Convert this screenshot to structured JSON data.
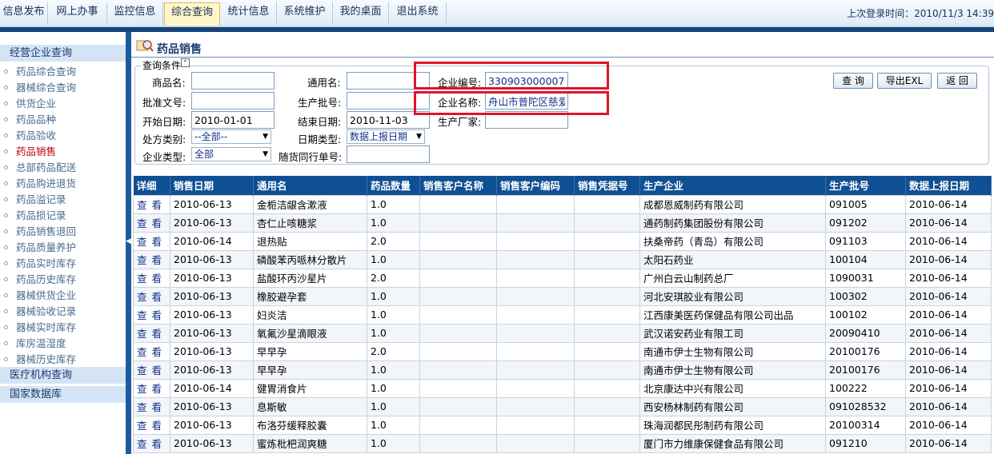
{
  "nav": {
    "items": [
      "信息发布",
      "网上办事",
      "监控信息",
      "综合查询",
      "统计信息",
      "系统维护",
      "我的桌面",
      "退出系统"
    ],
    "active": "综合查询",
    "last_login": "上次登录时间：2010/11/3 14:39"
  },
  "sidebar": {
    "section1": "经营企业查询",
    "items": [
      "药品综合查询",
      "器械综合查询",
      "供货企业",
      "药品品种",
      "药品验收",
      "药品销售",
      "总部药品配送",
      "药品购进退货",
      "药品溢记录",
      "药品损记录",
      "药品销售退回",
      "药品质量养护",
      "药品实时库存",
      "药品历史库存",
      "器械供货企业",
      "器械验收记录",
      "器械实时库存",
      "库房温湿度",
      "器械历史库存"
    ],
    "active": "药品销售",
    "section2": "医疗机构查询",
    "section3": "国家数据库"
  },
  "page": {
    "title": "药品销售"
  },
  "query": {
    "legend": "查询条件",
    "labels": {
      "product_name": "商品名:",
      "generic_name": "通用名:",
      "company_code": "企业编号:",
      "approval_no": "批准文号:",
      "batch_no": "生产批号:",
      "company_name": "企业名称:",
      "start_date": "开始日期:",
      "end_date": "结束日期:",
      "manufacturer": "生产厂家:",
      "rx_type": "处方类别:",
      "date_type": "日期类型:",
      "company_type": "企业类型:",
      "waybill_no": "随货同行单号:"
    },
    "values": {
      "company_code": "330903000007",
      "company_name": "舟山市普陀区慈爱药",
      "start_date": "2010-01-01",
      "end_date": "2010-11-03",
      "rx_type": "--全部--",
      "date_type": "数据上报日期",
      "company_type": "全部"
    },
    "buttons": {
      "search": "查 询",
      "export": "导出EXL",
      "back": "返 回"
    }
  },
  "table": {
    "columns": [
      "详细",
      "销售日期",
      "通用名",
      "药品数量",
      "销售客户名称",
      "销售客户编码",
      "销售凭据号",
      "生产企业",
      "生产批号",
      "数据上报日期"
    ],
    "view_label": "查看",
    "rows": [
      [
        "2010-06-13",
        "金栀洁龈含漱液",
        "1.0",
        "",
        "",
        "",
        "成都恩威制药有限公司",
        "091005",
        "2010-06-14"
      ],
      [
        "2010-06-13",
        "杏仁止咳糖浆",
        "1.0",
        "",
        "",
        "",
        "通药制药集团股份有限公司",
        "091202",
        "2010-06-14"
      ],
      [
        "2010-06-14",
        "退热贴",
        "2.0",
        "",
        "",
        "",
        "扶桑帝药（青岛）有限公司",
        "091103",
        "2010-06-14"
      ],
      [
        "2010-06-13",
        "磷酸苯丙哌林分散片",
        "1.0",
        "",
        "",
        "",
        "太阳石药业",
        "100104",
        "2010-06-14"
      ],
      [
        "2010-06-13",
        "盐酸环丙沙星片",
        "2.0",
        "",
        "",
        "",
        "广州白云山制药总厂",
        "1090031",
        "2010-06-14"
      ],
      [
        "2010-06-13",
        "橡胶避孕套",
        "1.0",
        "",
        "",
        "",
        "河北安琪胶业有限公司",
        "100302",
        "2010-06-14"
      ],
      [
        "2010-06-13",
        "妇炎洁",
        "1.0",
        "",
        "",
        "",
        "江西康美医药保健品有限公司出品",
        "100102",
        "2010-06-14"
      ],
      [
        "2010-06-13",
        "氧氟沙星滴眼液",
        "1.0",
        "",
        "",
        "",
        "武汉诺安药业有限工司",
        "20090410",
        "2010-06-14"
      ],
      [
        "2010-06-13",
        "早早孕",
        "2.0",
        "",
        "",
        "",
        "南通市伊士生物有限公司",
        "20100176",
        "2010-06-14"
      ],
      [
        "2010-06-13",
        "早早孕",
        "1.0",
        "",
        "",
        "",
        "南通市伊士生物有限公司",
        "20100176",
        "2010-06-14"
      ],
      [
        "2010-06-14",
        "健胃消食片",
        "1.0",
        "",
        "",
        "",
        "北京康达中兴有限公司",
        "100222",
        "2010-06-14"
      ],
      [
        "2010-06-13",
        "息斯敏",
        "1.0",
        "",
        "",
        "",
        "西安杨林制药有限公司",
        "091028532",
        "2010-06-14"
      ],
      [
        "2010-06-13",
        "布洛芬缓释胶囊",
        "1.0",
        "",
        "",
        "",
        "珠海润都民彤制药有限公司",
        "20100314",
        "2010-06-14"
      ],
      [
        "2010-06-13",
        "蜜炼枇杷润爽糖",
        "1.0",
        "",
        "",
        "",
        "厦门市力维康保健食品有限公司",
        "091210",
        "2010-06-14"
      ]
    ]
  }
}
